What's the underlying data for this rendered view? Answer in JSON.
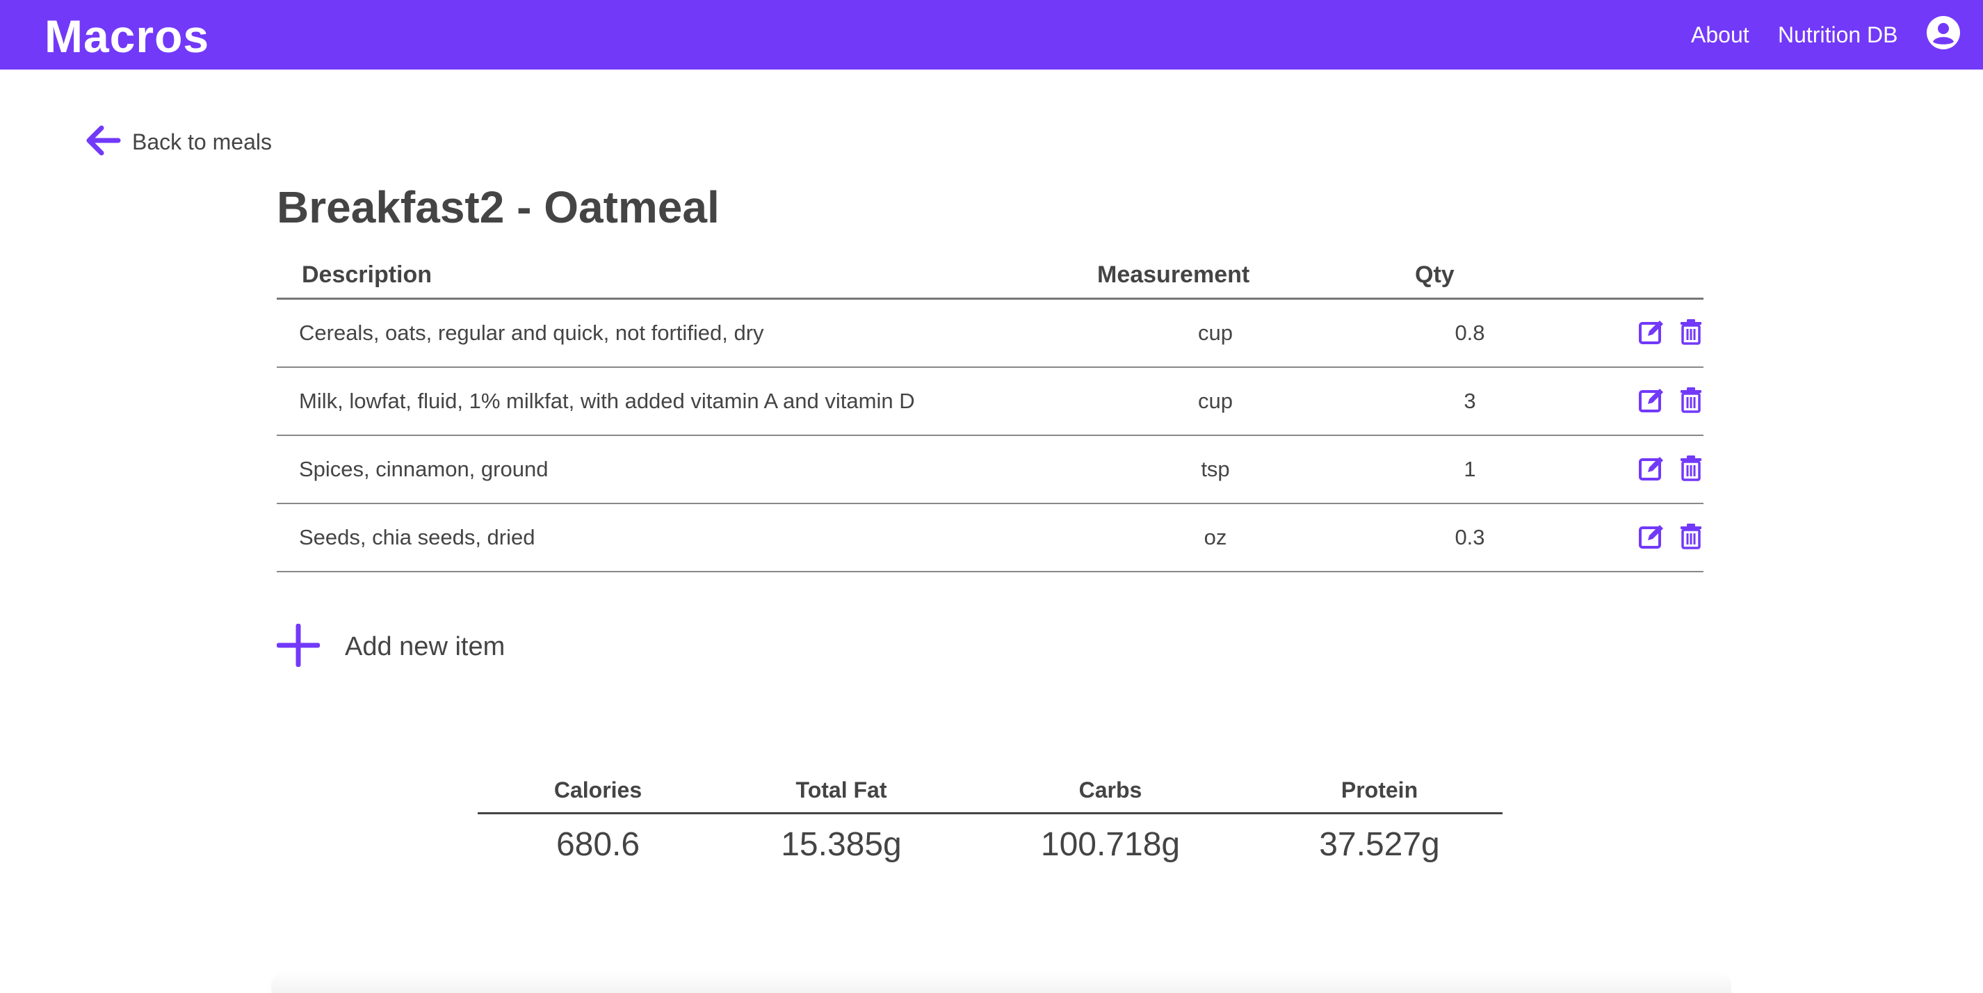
{
  "app": {
    "brand": "Macros",
    "nav": {
      "about": "About",
      "nutrition_db": "Nutrition DB"
    },
    "account_icon": "account-circle-icon",
    "accent_color": "#7239f9"
  },
  "back": {
    "label": "Back to meals",
    "icon": "arrow-left-icon"
  },
  "meal": {
    "title": "Breakfast2 - Oatmeal"
  },
  "items_table": {
    "headers": {
      "description": "Description",
      "measurement": "Measurement",
      "qty": "Qty"
    },
    "rows": [
      {
        "description": "Cereals, oats, regular and quick, not fortified, dry",
        "measurement": "cup",
        "qty": "0.8"
      },
      {
        "description": "Milk, lowfat, fluid, 1% milkfat, with added vitamin A and vitamin D",
        "measurement": "cup",
        "qty": "3"
      },
      {
        "description": "Spices, cinnamon, ground",
        "measurement": "tsp",
        "qty": "1"
      },
      {
        "description": "Seeds, chia seeds, dried",
        "measurement": "oz",
        "qty": "0.3"
      }
    ],
    "row_actions": [
      "edit-icon",
      "trash-icon"
    ]
  },
  "add_item": {
    "label": "Add new item",
    "icon": "plus-icon"
  },
  "totals": {
    "headers": {
      "calories": "Calories",
      "total_fat": "Total Fat",
      "carbs": "Carbs",
      "protein": "Protein"
    },
    "values": {
      "calories": "680.6",
      "total_fat": "15.385g",
      "carbs": "100.718g",
      "protein": "37.527g"
    }
  }
}
